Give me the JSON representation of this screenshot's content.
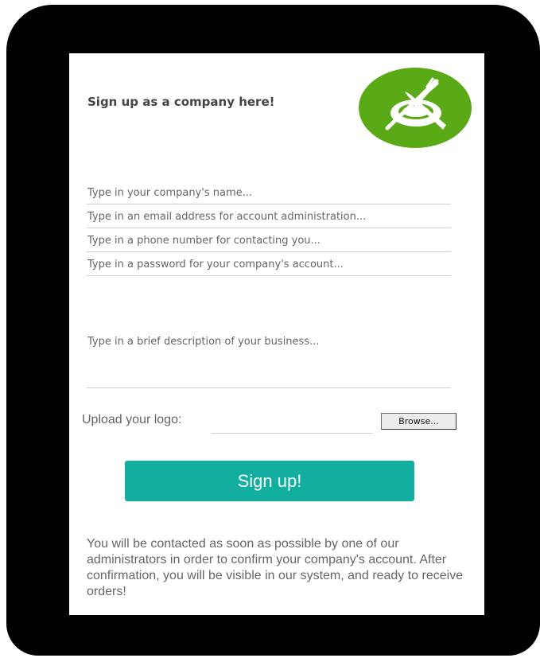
{
  "signup_form": {
    "heading": "Sign up as a company here!",
    "logo_icon": "plate-fork-knife-icon",
    "fields": {
      "company_name_placeholder": "Type in your company's name...",
      "email_placeholder": "Type in an email address for account administration...",
      "phone_placeholder": "Type in a phone number for contacting you...",
      "password_placeholder": "Type in a password for your company's account...",
      "description_placeholder": "Type in a brief description of your business..."
    },
    "upload": {
      "label": "Upload your logo:",
      "browse_label": "Browse..."
    },
    "submit_label": "Sign up!",
    "note": "You will be contacted as soon as possible by one of our administrators in order to confirm your company's account. After confirmation, you will be visible in our system, and ready to receive orders!"
  },
  "colors": {
    "accent": "#12aea0",
    "logo_green": "#5aa917",
    "frame": "#000000"
  }
}
